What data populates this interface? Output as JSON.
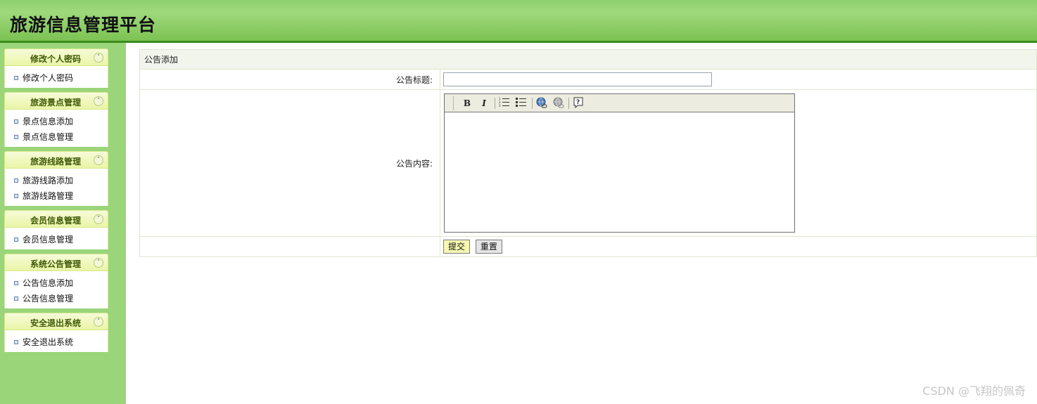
{
  "header": {
    "title": "旅游信息管理平台"
  },
  "sidebar": {
    "groups": [
      {
        "title": "修改个人密码",
        "items": [
          "修改个人密码"
        ]
      },
      {
        "title": "旅游景点管理",
        "items": [
          "景点信息添加",
          "景点信息管理"
        ]
      },
      {
        "title": "旅游线路管理",
        "items": [
          "旅游线路添加",
          "旅游线路管理"
        ]
      },
      {
        "title": "会员信息管理",
        "items": [
          "会员信息管理"
        ]
      },
      {
        "title": "系统公告管理",
        "items": [
          "公告信息添加",
          "公告信息管理"
        ]
      },
      {
        "title": "安全退出系统",
        "items": [
          "安全退出系统"
        ]
      }
    ]
  },
  "form": {
    "caption": "公告添加",
    "title_label": "公告标题:",
    "title_value": "",
    "content_label": "公告内容:",
    "toolbar": {
      "bold": "B",
      "italic": "I"
    },
    "submit_label": "提交",
    "reset_label": "重置"
  },
  "watermark": "CSDN @飞翔的佩奇",
  "colors": {
    "header": "#8fd06e",
    "sidebar": "#9bd57a",
    "menu_head": "#eaf5a7",
    "caption_bg": "#f1f5ec"
  }
}
